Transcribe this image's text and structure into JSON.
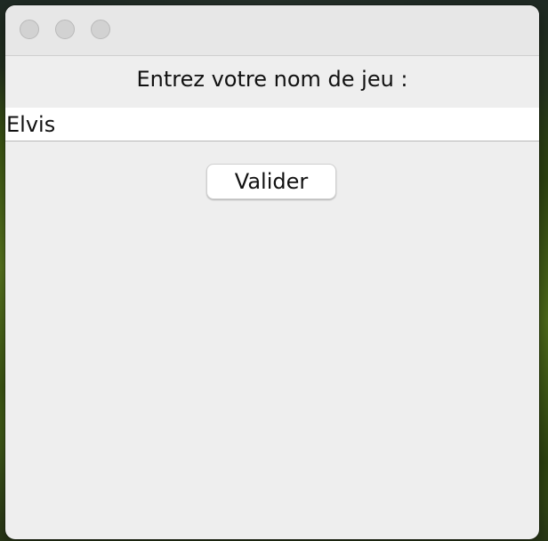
{
  "dialog": {
    "prompt_label": "Entrez votre nom de jeu :",
    "name_input": {
      "value": "Elvis",
      "placeholder": ""
    },
    "validate_button_label": "Valider"
  },
  "icons": {
    "close": "close-icon",
    "minimize": "minimize-icon",
    "zoom": "zoom-icon"
  },
  "colors": {
    "window_background": "#eeeeee",
    "titlebar_background": "#e7e7e7",
    "traffic_light_inactive": "#d2d2d2",
    "input_background": "#ffffff",
    "button_background": "#ffffff"
  }
}
